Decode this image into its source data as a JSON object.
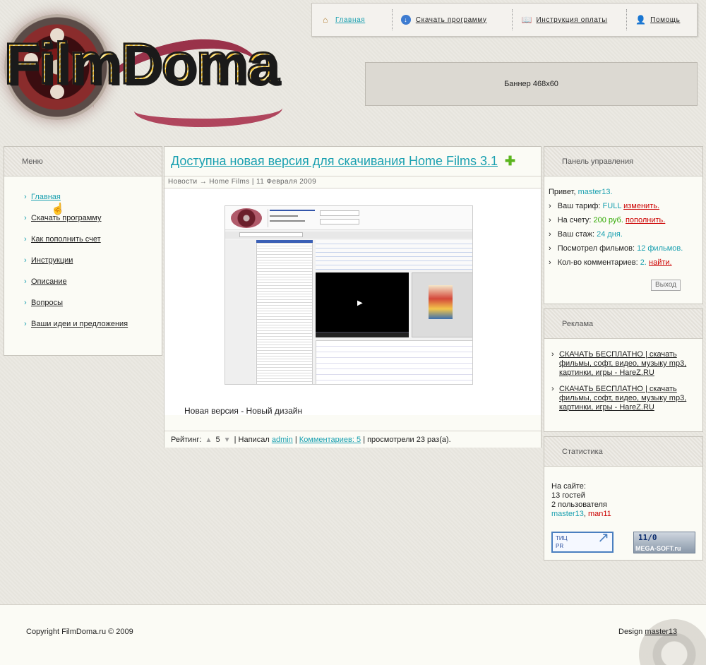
{
  "site": {
    "logo_text": "FilmDoma"
  },
  "topnav": {
    "items": [
      {
        "label": "Главная",
        "icon": "home-icon"
      },
      {
        "label": "Скачать программу",
        "icon": "download-icon"
      },
      {
        "label": "Инструкция оплаты",
        "icon": "book-icon"
      },
      {
        "label": "Помощь",
        "icon": "user-help-icon"
      }
    ]
  },
  "banner": {
    "text": "Баннер 468x60"
  },
  "menu": {
    "title": "Меню",
    "items": [
      "Главная",
      "Скачать программу",
      "Как пополнить счет",
      "Инструкции",
      "Описание",
      "Вопросы",
      "Ваши идеи и предложения"
    ]
  },
  "news": {
    "title": "Доступна новая версия для скачивания Home Films 3.1",
    "meta_section": "Новости",
    "meta_arrow": "→",
    "meta_category": "Home Films",
    "meta_sep": "|",
    "meta_date": "11 Февраля 2009",
    "caption": "Новая версия - Новый дизайн",
    "footer": {
      "rating_label": "Рейтинг:",
      "rating_value": "5",
      "author_prefix": "| Написал",
      "author": "admin",
      "sep": "|",
      "comments": "Комментариев: 5",
      "views": "| просмотрели 23 раз(а)."
    }
  },
  "control": {
    "title": "Панель управления",
    "greeting_prefix": "Привет,",
    "user": "master13.",
    "tariff_label": "Ваш тариф:",
    "tariff_value": "FULL",
    "tariff_action": "изменить.",
    "balance_label": "На счету:",
    "balance_value": "200 руб.",
    "balance_action": "пополнить.",
    "tenure_label": "Ваш стаж:",
    "tenure_value": "24 дня.",
    "watched_label": "Посмотрел фильмов:",
    "watched_value": "12 фильмов.",
    "comments_label": "Кол-во комментариев:",
    "comments_value": "2.",
    "comments_action": "найти.",
    "logout": "Выход"
  },
  "ads": {
    "title": "Реклама",
    "items": [
      "СКАЧАТЬ БЕСПЛАТНО | скачать фильмы, софт, видео, музыку mp3, картинки, игры - HareZ.RU",
      "СКАЧАТЬ БЕСПЛАТНО | скачать фильмы, софт, видео, музыку mp3, картинки, игры - HareZ.RU"
    ]
  },
  "stats": {
    "title": "Статистика",
    "online_label": "На сайте:",
    "guests": "13 гостей",
    "users": "2 пользователя",
    "user1": "master13",
    "user_sep": ",",
    "user2": "man11",
    "tic_line1": "ТИЦ",
    "tic_line2": "PR",
    "counter_value": "11/0",
    "counter_label": "MEGA-SOFT.ru"
  },
  "footer": {
    "copyright": "Copyright FilmDoma.ru © 2009",
    "design_prefix": "Design",
    "designer": "master13"
  },
  "colors": {
    "accent": "#1aa0b0",
    "green": "#2fa800",
    "red": "#cc0000"
  }
}
